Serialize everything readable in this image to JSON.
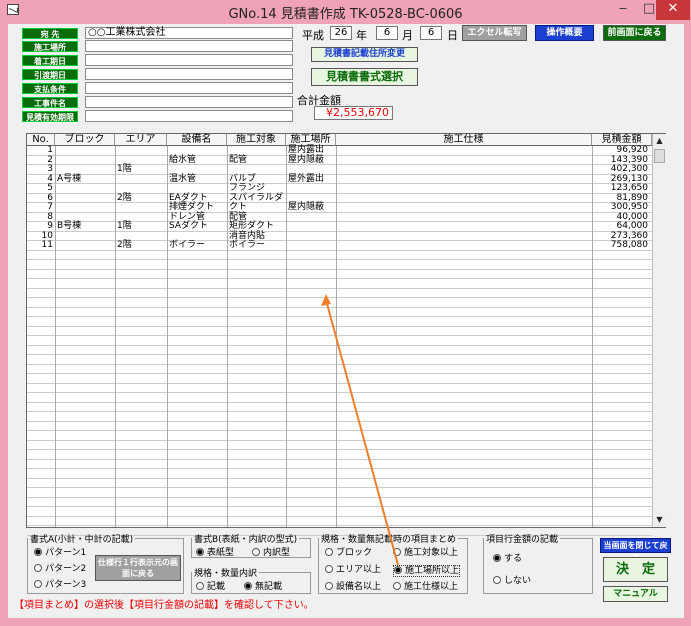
{
  "window": {
    "title": "GNo.14 見積書作成 TK-0528-BC-0606",
    "controls": {
      "min": "‒",
      "max": "□",
      "close": "✕"
    }
  },
  "form_labels": [
    "宛 先",
    "施工場所",
    "着工期日",
    "引渡期日",
    "支払条件",
    "工事件名",
    "見積有効期限"
  ],
  "form_values": [
    "○○工業株式会社",
    "",
    "",
    "",
    "",
    "",
    ""
  ],
  "date": {
    "era": "平成",
    "year": "26",
    "year_suffix": "年",
    "month": "6",
    "month_suffix": "月",
    "day": "6",
    "day_suffix": "日"
  },
  "buttons": {
    "excel": "エクセル転写",
    "manual_overview": "操作概要",
    "back": "前画面に戻る",
    "address_change": "見積書記載住所変更",
    "format_select": "見積書書式選択",
    "close_back": "当画面を閉じて戻る",
    "decide": "決　定",
    "manual": "マニュアル",
    "spec_return": "仕様行１行表示元の画面に戻る"
  },
  "total": {
    "label": "合計金額",
    "value": "¥2,553,670"
  },
  "table": {
    "headers": [
      "No.",
      "ブロック",
      "エリア",
      "設備名",
      "施工対象",
      "施工場所",
      "施工仕様",
      "見積金額"
    ],
    "rows": [
      {
        "no": "1",
        "block": "",
        "area": "",
        "equip": "",
        "target": "",
        "place": "屋内露出",
        "amount": "96,920"
      },
      {
        "no": "2",
        "block": "",
        "area": "",
        "equip": "給水管",
        "target": "配管",
        "place": "屋内隠蔽",
        "amount": "143,390"
      },
      {
        "no": "3",
        "block": "",
        "area": "1階",
        "equip": "",
        "target": "",
        "place": "",
        "amount": "402,300"
      },
      {
        "no": "4",
        "block": "A号棟",
        "area": "",
        "equip": "温水管",
        "target": "バルブ",
        "place": "屋外露出",
        "amount": "269,130"
      },
      {
        "no": "5",
        "block": "",
        "area": "",
        "equip": "",
        "target": "フランジ",
        "place": "",
        "amount": "123,650"
      },
      {
        "no": "6",
        "block": "",
        "area": "2階",
        "equip": "EAダクト",
        "target": "スパイラルダクト",
        "place": "",
        "amount": "81,890"
      },
      {
        "no": "7",
        "block": "",
        "area": "",
        "equip": "排煙ダクト",
        "target": "",
        "place": "屋内隠蔽",
        "amount": "300,950"
      },
      {
        "no": "8",
        "block": "",
        "area": "",
        "equip": "ドレン管",
        "target": "配管",
        "place": "",
        "amount": "40,000"
      },
      {
        "no": "9",
        "block": "B号棟",
        "area": "1階",
        "equip": "SAダクト",
        "target": "矩形ダクト",
        "place": "",
        "amount": "64,000"
      },
      {
        "no": "10",
        "block": "",
        "area": "",
        "equip": "",
        "target": "消音内貼",
        "place": "",
        "amount": "273,360"
      },
      {
        "no": "11",
        "block": "",
        "area": "2階",
        "equip": "ボイラー",
        "target": "ボイラー",
        "place": "",
        "amount": "758,080"
      }
    ]
  },
  "formatA": {
    "title": "書式A(小計・中計の記載)",
    "options": [
      "パターン1",
      "パターン2",
      "パターン3"
    ],
    "selected": 0
  },
  "formatB": {
    "title": "書式B(表紙・内訳の型式)",
    "options": [
      "表紙型",
      "内訳型"
    ],
    "selected": 0
  },
  "spec_detail": {
    "title": "規格・数量内訳",
    "options": [
      "記載",
      "無記載"
    ],
    "selected": 1
  },
  "grouping": {
    "title": "規格・数量無記載時の項目まとめ",
    "options": [
      "ブロック",
      "エリア以上",
      "設備名以上",
      "施工対象以上",
      "施工場所以上",
      "施工仕様以上"
    ],
    "selected": 4
  },
  "item_amount": {
    "title": "項目行金額の記載",
    "options": [
      "する",
      "しない"
    ],
    "selected": 0
  },
  "warning": "【項目まとめ】の選択後【項目行金額の記載】を確認して下さい。",
  "colors": {
    "title_bg": "#f0a3b6",
    "label_bg": "#0a6b0a",
    "accent_blue": "#1a3fd0",
    "total_red": "#e00000",
    "arrow": "#f07e2a"
  }
}
